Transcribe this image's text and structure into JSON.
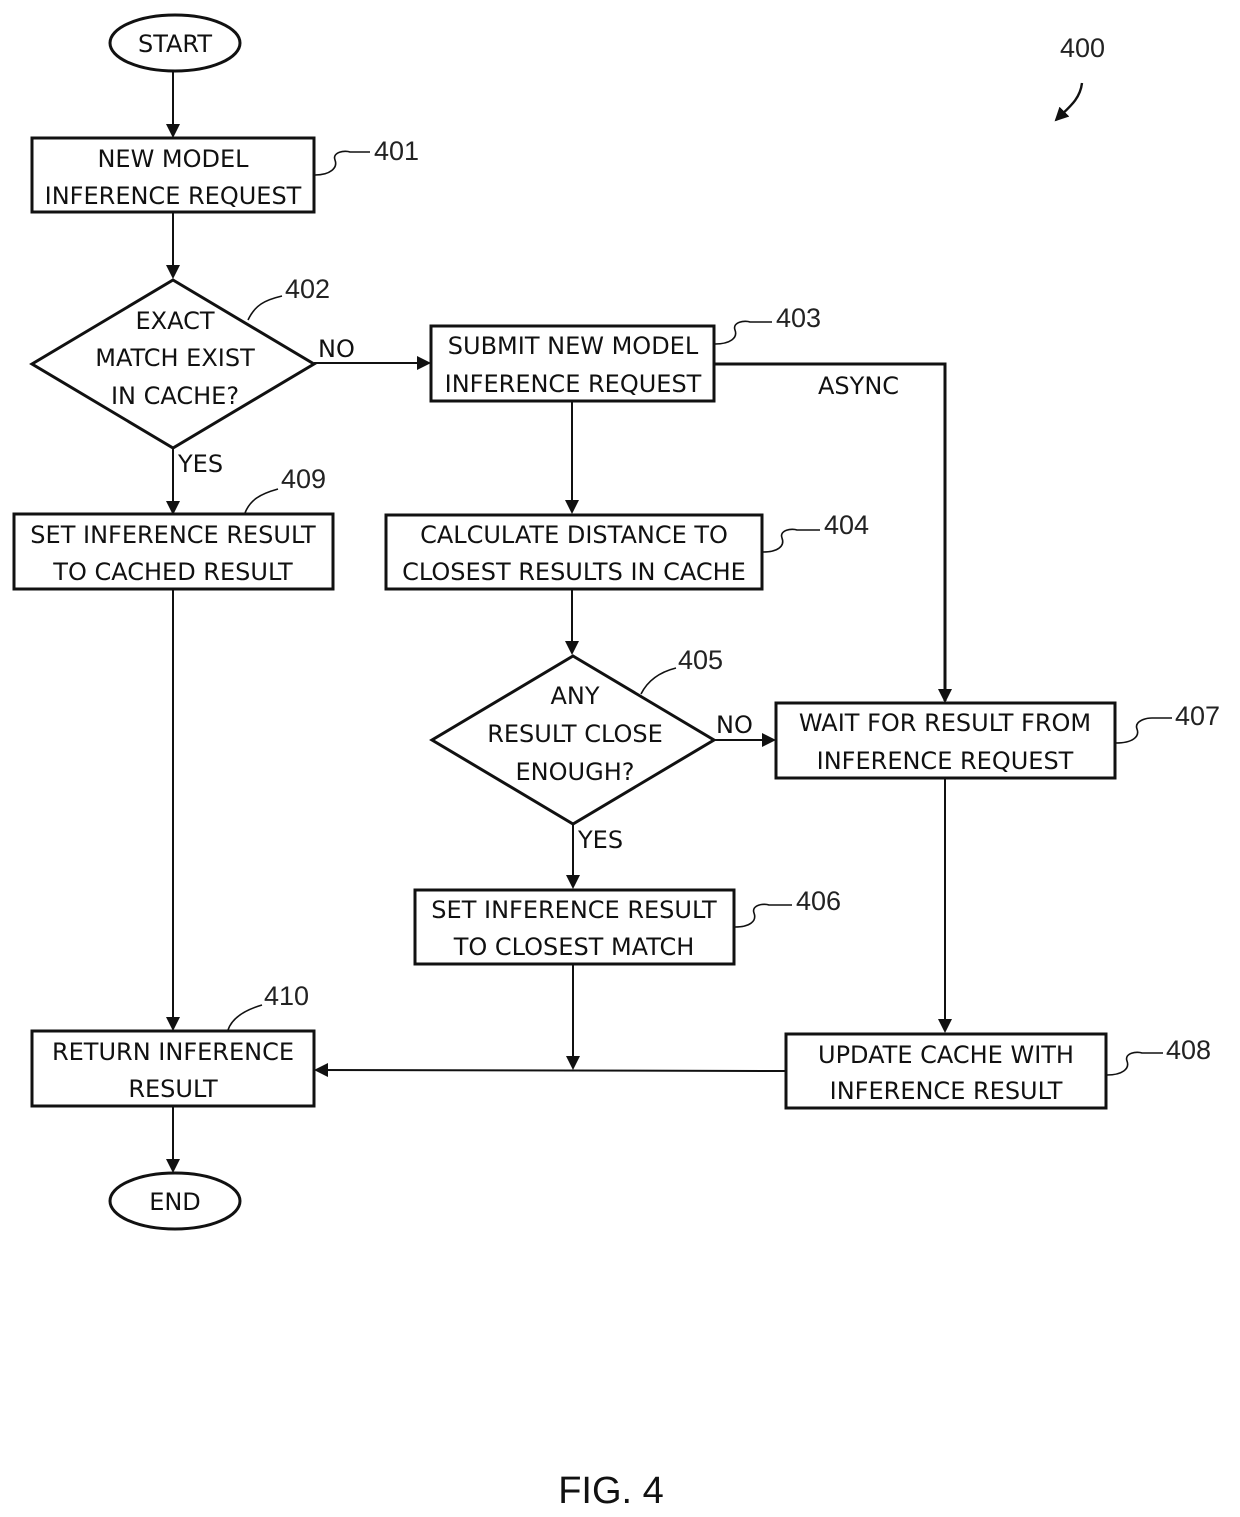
{
  "figure": {
    "label": "FIG. 4",
    "reference": "400"
  },
  "nodes": {
    "start": {
      "label": "START"
    },
    "n401": {
      "ref": "401",
      "lines": [
        "NEW MODEL",
        "INFERENCE REQUEST"
      ]
    },
    "n402": {
      "ref": "402",
      "lines": [
        "EXACT",
        "MATCH EXIST",
        "IN CACHE?"
      ]
    },
    "n403": {
      "ref": "403",
      "lines": [
        "SUBMIT NEW MODEL",
        "INFERENCE REQUEST"
      ]
    },
    "n404": {
      "ref": "404",
      "lines": [
        "CALCULATE DISTANCE TO",
        "CLOSEST RESULTS IN CACHE"
      ]
    },
    "n405": {
      "ref": "405",
      "lines": [
        "ANY",
        "RESULT CLOSE",
        "ENOUGH?"
      ]
    },
    "n406": {
      "ref": "406",
      "lines": [
        "SET INFERENCE RESULT",
        "TO CLOSEST MATCH"
      ]
    },
    "n407": {
      "ref": "407",
      "lines": [
        "WAIT FOR RESULT FROM",
        "INFERENCE REQUEST"
      ]
    },
    "n408": {
      "ref": "408",
      "lines": [
        "UPDATE CACHE WITH",
        "INFERENCE RESULT"
      ]
    },
    "n409": {
      "ref": "409",
      "lines": [
        "SET INFERENCE RESULT",
        "TO CACHED RESULT"
      ]
    },
    "n410": {
      "ref": "410",
      "lines": [
        "RETURN INFERENCE",
        "RESULT"
      ]
    },
    "end": {
      "label": "END"
    }
  },
  "edge_labels": {
    "n402_no": "NO",
    "n402_yes": "YES",
    "n403_async": "ASYNC",
    "n405_no": "NO",
    "n405_yes": "YES"
  }
}
